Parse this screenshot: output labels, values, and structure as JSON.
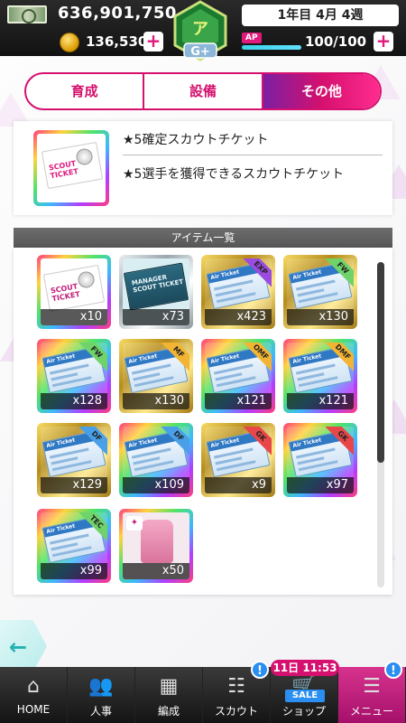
{
  "status": {
    "money": "636,901,750",
    "coins": "136,530",
    "date": "1年目 4月 4週",
    "ap_label": "AP",
    "ap_value": "100/100",
    "ap_fraction": 1.0,
    "rank_label": "G+"
  },
  "tabs": [
    {
      "label": "育成",
      "active": false
    },
    {
      "label": "設備",
      "active": false
    },
    {
      "label": "その他",
      "active": true
    }
  ],
  "detail": {
    "name": "★5確定スカウトチケット",
    "description": "★5選手を獲得できるスカウトチケット",
    "thumb_text": "SCOUT TICKET"
  },
  "list": {
    "header": "アイテム一覧",
    "items": [
      {
        "frame": "rainbow",
        "kind": "scout",
        "art_text": "SCOUT TICKET",
        "count": "x10"
      },
      {
        "frame": "silver",
        "kind": "manager",
        "art_text": "MANAGER SCOUT TICKET",
        "count": "x73"
      },
      {
        "frame": "gold",
        "kind": "air",
        "art_text": "Air Ticket",
        "ribbon": "EXP",
        "ribbon_color": "#9b4be0",
        "count": "x423"
      },
      {
        "frame": "gold",
        "kind": "air",
        "art_text": "Air Ticket",
        "ribbon": "FW",
        "ribbon_color": "#6fd36a",
        "count": "x130"
      },
      {
        "frame": "rainbow",
        "kind": "air",
        "art_text": "Air Ticket",
        "ribbon": "FW",
        "ribbon_color": "#6fd36a",
        "count": "x128"
      },
      {
        "frame": "gold",
        "kind": "air",
        "art_text": "Air Ticket",
        "ribbon": "MF",
        "ribbon_color": "#f2b432",
        "count": "x130"
      },
      {
        "frame": "rainbow",
        "kind": "air",
        "art_text": "Air Ticket",
        "ribbon": "OMF",
        "ribbon_color": "#f2b432",
        "count": "x121"
      },
      {
        "frame": "rainbow",
        "kind": "air",
        "art_text": "Air Ticket",
        "ribbon": "DMF",
        "ribbon_color": "#f2b432",
        "count": "x121"
      },
      {
        "frame": "gold",
        "kind": "air",
        "art_text": "Air Ticket",
        "ribbon": "DF",
        "ribbon_color": "#4aa0e8",
        "count": "x129"
      },
      {
        "frame": "rainbow",
        "kind": "air",
        "art_text": "Air Ticket",
        "ribbon": "DF",
        "ribbon_color": "#4aa0e8",
        "count": "x109"
      },
      {
        "frame": "gold",
        "kind": "air",
        "art_text": "Air Ticket",
        "ribbon": "GK",
        "ribbon_color": "#e8474a",
        "count": "x9"
      },
      {
        "frame": "rainbow",
        "kind": "air",
        "art_text": "Air Ticket",
        "ribbon": "GK",
        "ribbon_color": "#e8474a",
        "count": "x97"
      },
      {
        "frame": "rainbow",
        "kind": "air",
        "art_text": "Air Ticket",
        "ribbon": "TEC",
        "ribbon_color": "#6fd36a",
        "count": "x99"
      },
      {
        "frame": "rainbow",
        "kind": "outfit",
        "count": "x50"
      }
    ]
  },
  "nav": {
    "items": [
      {
        "label": "HOME",
        "icon": "home-icon",
        "glyph": "⌂"
      },
      {
        "label": "人事",
        "icon": "people-icon",
        "glyph": "👥"
      },
      {
        "label": "編成",
        "icon": "pitch-icon",
        "glyph": "▦"
      },
      {
        "label": "スカウト",
        "icon": "scout-icon",
        "glyph": "☷"
      },
      {
        "label": "ショップ",
        "icon": "cart-icon",
        "glyph": "🛒"
      },
      {
        "label": "メニュー",
        "icon": "menu-icon",
        "glyph": "☰"
      }
    ],
    "sale_timer": "11日 11:53",
    "sale_tag": "SALE",
    "badge": "!"
  },
  "colors": {
    "accent": "#d5106e",
    "teal": "#22b2b0"
  }
}
